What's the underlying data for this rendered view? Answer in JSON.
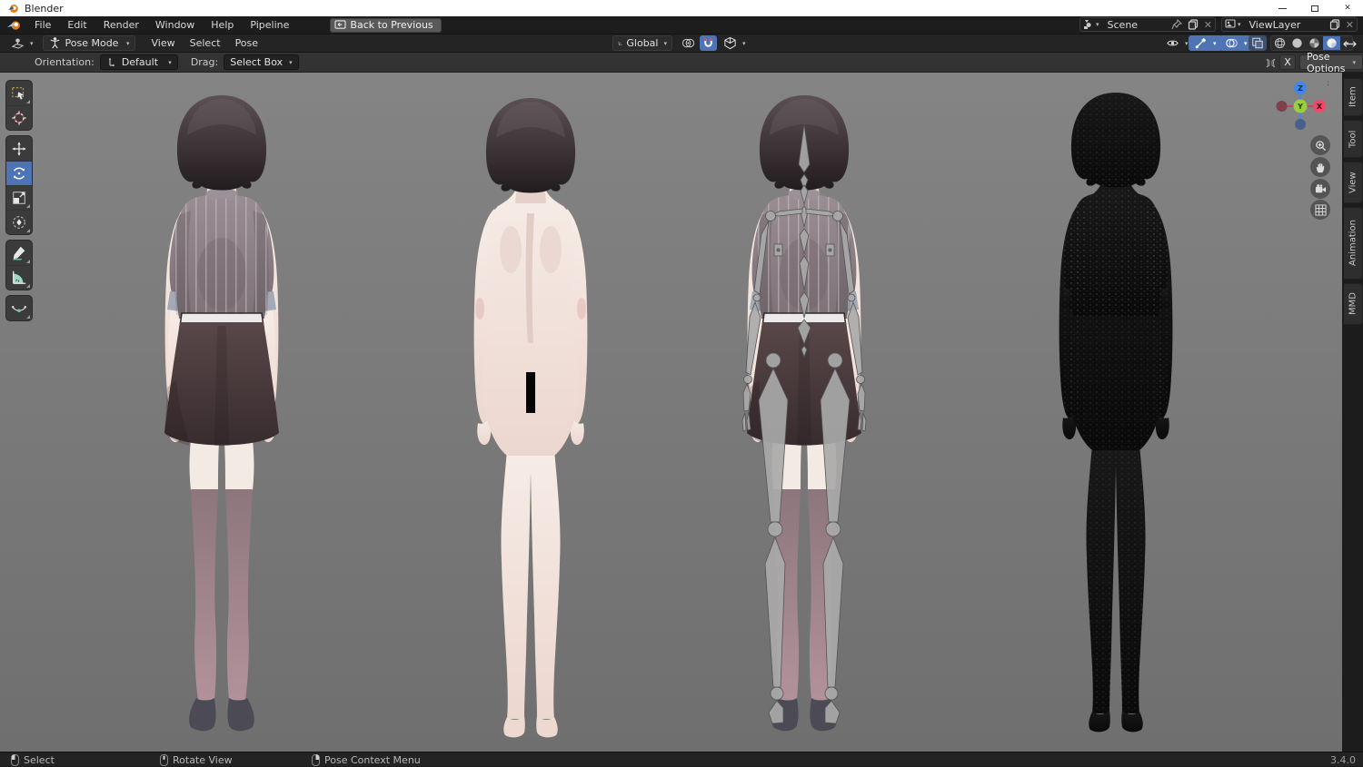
{
  "app": {
    "title": "Blender",
    "version": "3.4.0"
  },
  "menubar": {
    "items": [
      "File",
      "Edit",
      "Render",
      "Window",
      "Help",
      "Pipeline"
    ],
    "back_button": "Back to Previous"
  },
  "viewport_header": {
    "mode": "Pose Mode",
    "menus": [
      "View",
      "Select",
      "Pose"
    ],
    "orientation": "Global"
  },
  "tool_settings": {
    "orientation_label": "Orientation:",
    "orientation_value": "Default",
    "drag_label": "Drag:",
    "drag_value": "Select Box",
    "mirror_label": "X",
    "pose_options": "Pose Options"
  },
  "scene_bar": {
    "scene": "Scene",
    "view_layer": "ViewLayer"
  },
  "sidebar_tabs": [
    "Item",
    "Tool",
    "View",
    "Animation",
    "MMD"
  ],
  "gizmo": {
    "top": "Z",
    "center": "Y",
    "right": "X"
  },
  "toolbar_tools": [
    "select-box",
    "cursor",
    "move",
    "rotate",
    "scale",
    "transform",
    "annotate",
    "measure",
    "pose-breakdowner"
  ],
  "active_tool": "rotate",
  "statusbar": {
    "hints": [
      {
        "icon": "mouse-left",
        "label": "Select"
      },
      {
        "icon": "mouse-middle",
        "label": "Rotate View"
      },
      {
        "icon": "mouse-right",
        "label": "Pose Context Menu"
      }
    ],
    "version": "3.4.0"
  },
  "colors": {
    "accent": "#4f74b6",
    "viewport_bg": "#787878",
    "axis_x": "#ef4968",
    "axis_y": "#9ace3b",
    "axis_z": "#3f87ee"
  }
}
